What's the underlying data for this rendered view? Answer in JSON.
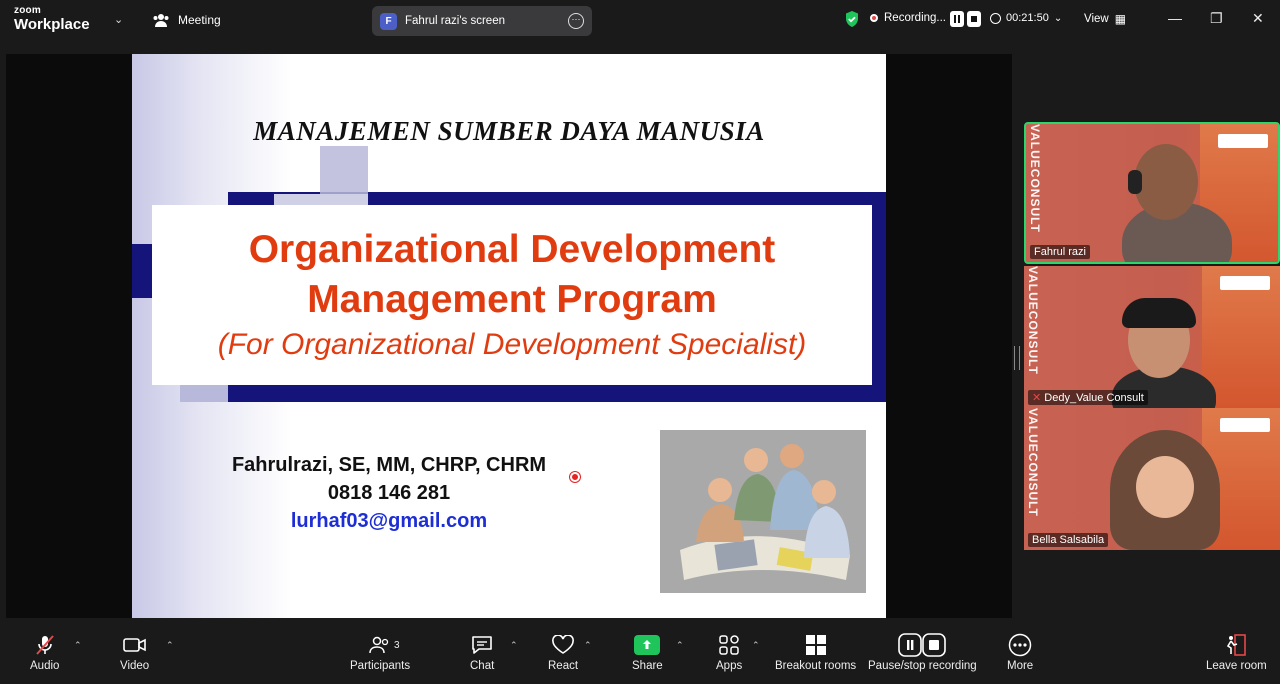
{
  "app": {
    "brand_small": "zoom",
    "brand_big": "Workplace",
    "meeting_label": "Meeting",
    "screen_share_label": "Fahrul razi's screen",
    "screen_share_badge": "F",
    "recording_label": "Recording...",
    "timer": "00:21:50",
    "view_label": "View",
    "accent_green": "#1fc45a",
    "record_red": "#e54848"
  },
  "slide": {
    "heading": "MANAJEMEN SUMBER DAYA MANUSIA",
    "title_line1": "Organizational Development",
    "title_line2": "Management Program",
    "subtitle": "(For Organizational Development Specialist)",
    "author": "Fahrulrazi, SE, MM, CHRP, CHRM",
    "phone": "0818 146 281",
    "email": "lurhaf03@gmail.com",
    "title_color": "#e13b10",
    "band_color": "#14147a"
  },
  "participants": [
    {
      "name": "Fahrul razi",
      "active": true
    },
    {
      "name": "Dedy_Value Consult",
      "active": false
    },
    {
      "name": "Bella Salsabila",
      "active": false
    }
  ],
  "tile_brand": "VALUECONSULT",
  "toolbar": {
    "audio": "Audio",
    "video": "Video",
    "participants": "Participants",
    "participants_count": "3",
    "chat": "Chat",
    "react": "React",
    "share": "Share",
    "apps": "Apps",
    "breakout": "Breakout rooms",
    "pause_stop": "Pause/stop recording",
    "more": "More",
    "leave": "Leave room"
  }
}
